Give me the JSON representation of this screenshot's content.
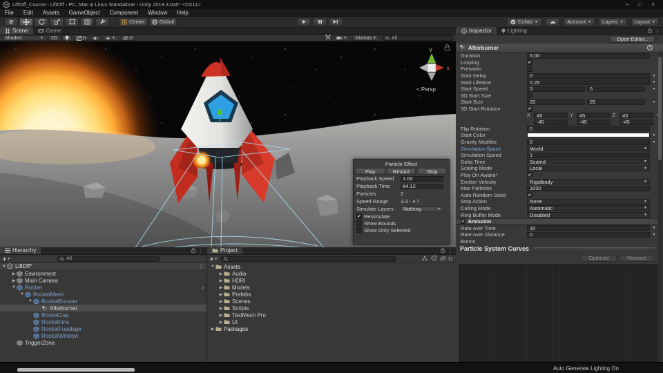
{
  "window": {
    "title": "LiftOff_Course - LiftOff - PC, Mac & Linux Standalone - Unity 2019.3.0a5* <DX11>",
    "controls": {
      "minimize": "–",
      "maximize": "□",
      "close": "×"
    }
  },
  "menu_bar": {
    "items": [
      "File",
      "Edit",
      "Assets",
      "GameObject",
      "Component",
      "Window",
      "Help"
    ]
  },
  "toolbar": {
    "tools": [
      {
        "name": "hand-tool",
        "active": false
      },
      {
        "name": "move-tool",
        "active": true
      },
      {
        "name": "rotate-tool",
        "active": false
      },
      {
        "name": "scale-tool",
        "active": false
      },
      {
        "name": "rect-tool",
        "active": false
      },
      {
        "name": "transform-tool",
        "active": false
      },
      {
        "name": "custom-tool",
        "active": false
      }
    ],
    "pivot_label": "Center",
    "space_label": "Global",
    "collab_label": "Collab",
    "account_label": "Account",
    "layers_label": "Layers",
    "layout_label": "Layout"
  },
  "scene_view": {
    "tabs": [
      {
        "label": "Scene",
        "active": true
      },
      {
        "label": "Game",
        "active": false
      }
    ],
    "controls": {
      "draw_mode": "Shaded",
      "toggle_2d": "2D",
      "exposure_count": "0",
      "hidden_objects_count": "0",
      "gizmos_label": "Gizmos",
      "search_value": "All"
    },
    "axis_gizmo": {
      "x_label": "x",
      "y_label": "y",
      "persp_label": "< Persp"
    }
  },
  "particle_effect_panel": {
    "title": "Particle Effect",
    "buttons": [
      "Play",
      "Restart",
      "Stop"
    ],
    "rows": [
      {
        "label": "Playback Speed",
        "value": "1.00",
        "control": "field"
      },
      {
        "label": "Playback Time",
        "value": "64.12",
        "control": "field"
      },
      {
        "label": "Particles",
        "value": "2",
        "control": "static"
      },
      {
        "label": "Speed Range",
        "value": "3.3 - 4.7",
        "control": "static"
      },
      {
        "label": "Simulate Layers",
        "value": "Nothing",
        "control": "dropdown"
      }
    ],
    "checks": [
      {
        "label": "Resimulate",
        "checked": true
      },
      {
        "label": "Show Bounds",
        "checked": false
      },
      {
        "label": "Show Only Selected",
        "checked": false
      }
    ]
  },
  "hierarchy": {
    "tab_label": "Hierarchy",
    "add_label": "+",
    "search_value": "All",
    "items": [
      {
        "label": "LiftOff*",
        "depth": 0,
        "fold": "open",
        "icon": "unity",
        "style": "scene"
      },
      {
        "label": "Environment",
        "depth": 1,
        "fold": "closed",
        "icon": "cube",
        "style": "plain"
      },
      {
        "label": "Main Camera",
        "depth": 1,
        "fold": "closed",
        "icon": "cube",
        "style": "plain"
      },
      {
        "label": "Rocket",
        "depth": 1,
        "fold": "open",
        "icon": "cubeblue",
        "style": "prefab",
        "more": true
      },
      {
        "label": "RocketMesh",
        "depth": 2,
        "fold": "open",
        "icon": "cubeblue",
        "style": "prefab"
      },
      {
        "label": "RocketBooster",
        "depth": 3,
        "fold": "open",
        "icon": "cubeblue",
        "style": "prefab"
      },
      {
        "label": "Afterburner",
        "depth": 4,
        "fold": "none",
        "icon": "particle",
        "style": "selected"
      },
      {
        "label": "RocketCap",
        "depth": 3,
        "fold": "none",
        "icon": "cubeblue",
        "style": "prefab"
      },
      {
        "label": "RocketFins",
        "depth": 3,
        "fold": "none",
        "icon": "cubeblue",
        "style": "prefab"
      },
      {
        "label": "RocketFuselage",
        "depth": 3,
        "fold": "none",
        "icon": "cubeblue",
        "style": "prefab"
      },
      {
        "label": "RocketWindow",
        "depth": 3,
        "fold": "none",
        "icon": "cubeblue",
        "style": "prefab"
      },
      {
        "label": "TriggerZone",
        "depth": 1,
        "fold": "none",
        "icon": "cube",
        "style": "plain"
      }
    ]
  },
  "project": {
    "tab_label": "Project",
    "add_label": "+",
    "search_value": "",
    "hidden_count": "11",
    "items": [
      {
        "label": "Assets",
        "depth": 0,
        "fold": "open",
        "bold": true
      },
      {
        "label": "Audio",
        "depth": 1,
        "fold": "closed"
      },
      {
        "label": "HDRI",
        "depth": 1,
        "fold": "closed"
      },
      {
        "label": "Models",
        "depth": 1,
        "fold": "closed"
      },
      {
        "label": "Prefabs",
        "depth": 1,
        "fold": "closed"
      },
      {
        "label": "Scenes",
        "depth": 1,
        "fold": "closed"
      },
      {
        "label": "Scripts",
        "depth": 1,
        "fold": "closed"
      },
      {
        "label": "TextMesh Pro",
        "depth": 1,
        "fold": "closed"
      },
      {
        "label": "UI",
        "depth": 1,
        "fold": "closed"
      },
      {
        "label": "Packages",
        "depth": 0,
        "fold": "closed",
        "bold": true
      }
    ]
  },
  "inspector": {
    "tabs": [
      {
        "label": "Inspector",
        "active": true
      },
      {
        "label": "Lighting",
        "active": false
      }
    ],
    "open_editor_label": "Open Editor...",
    "component_name": "Afterburner",
    "rows": [
      {
        "t": "field",
        "label": "Duration",
        "value": "5.00"
      },
      {
        "t": "check",
        "label": "Looping",
        "checked": true
      },
      {
        "t": "check",
        "label": "Prewarm",
        "checked": false
      },
      {
        "t": "field",
        "label": "Start Delay",
        "value": "0",
        "dd": true
      },
      {
        "t": "field",
        "label": "Start Lifetime",
        "value": "0.25",
        "dd": true
      },
      {
        "t": "minmax",
        "label": "Start Speed",
        "min": "3",
        "max": "5",
        "dd": true
      },
      {
        "t": "check",
        "label": "3D Start Size",
        "checked": false
      },
      {
        "t": "minmax",
        "label": "Start Size",
        "min": "20",
        "max": "25",
        "dd": true
      },
      {
        "t": "check",
        "label": "3D Start Rotation",
        "checked": true
      },
      {
        "t": "vec3",
        "axes": [
          "X",
          "Y",
          "Z"
        ],
        "values": [
          "45",
          "45",
          "45"
        ],
        "dd": true
      },
      {
        "t": "vec3",
        "axes": [
          "",
          "",
          ""
        ],
        "values": [
          "-45",
          "-45",
          "-45"
        ]
      },
      {
        "t": "field",
        "label": "Flip Rotation",
        "value": "0"
      },
      {
        "t": "color",
        "label": "Start Color",
        "dd": true
      },
      {
        "t": "field",
        "label": "Gravity Modifier",
        "value": "0",
        "dd": true
      },
      {
        "t": "dropdown",
        "label": "Simulation Space",
        "value": "World",
        "labelStyle": "override"
      },
      {
        "t": "field",
        "label": "Simulation Speed",
        "value": "1"
      },
      {
        "t": "dropdown",
        "label": "Delta Time",
        "value": "Scaled"
      },
      {
        "t": "dropdown",
        "label": "Scaling Mode",
        "value": "Local"
      },
      {
        "t": "check",
        "label": "Play On Awake*",
        "checked": true
      },
      {
        "t": "dropdown",
        "label": "Emitter Velocity",
        "value": "Rigidbody"
      },
      {
        "t": "field",
        "label": "Max Particles",
        "value": "1000"
      },
      {
        "t": "check",
        "label": "Auto Random Seed",
        "checked": true
      },
      {
        "t": "dropdown",
        "label": "Stop Action",
        "value": "None"
      },
      {
        "t": "dropdown",
        "label": "Culling Mode",
        "value": "Automatic"
      },
      {
        "t": "dropdown",
        "label": "Ring Buffer Mode",
        "value": "Disabled"
      },
      {
        "t": "section",
        "label": "Emission",
        "checked": true
      },
      {
        "t": "field",
        "label": "Rate over Time",
        "value": "10",
        "dd": true
      },
      {
        "t": "field",
        "label": "Rate over Distance",
        "value": "0",
        "dd": true
      },
      {
        "t": "plain",
        "label": "Bursts"
      }
    ],
    "curves": {
      "title": "Particle System Curves",
      "optimize_label": "Optimize",
      "remove_label": "Remove"
    }
  },
  "status_bar": {
    "lighting_status": "Auto Generate Lighting On"
  }
}
